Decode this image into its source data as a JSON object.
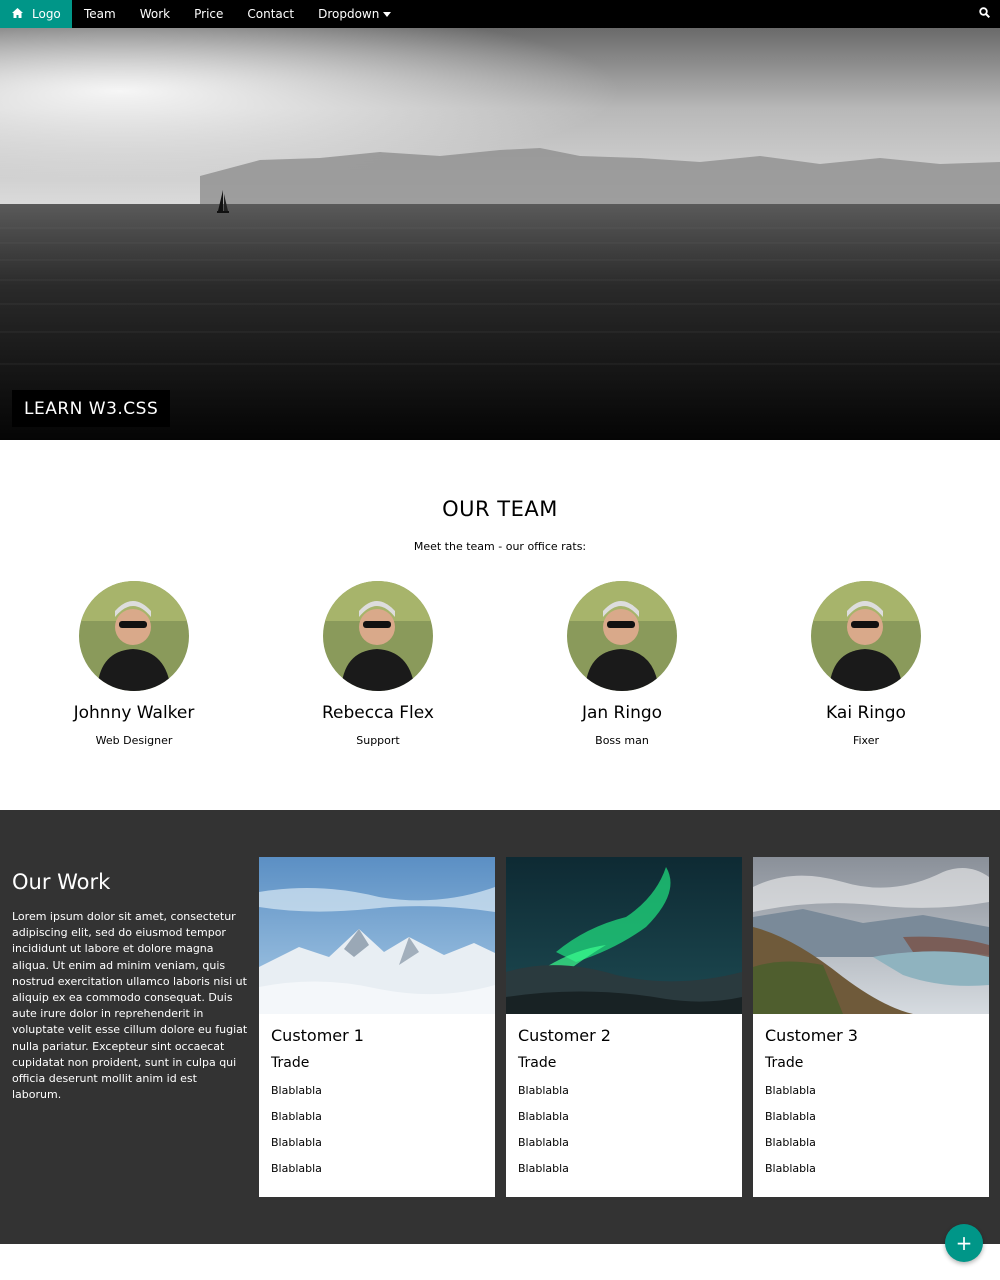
{
  "nav": {
    "logo_label": "Logo",
    "items": [
      {
        "label": "Team"
      },
      {
        "label": "Work"
      },
      {
        "label": "Price"
      },
      {
        "label": "Contact"
      },
      {
        "label": "Dropdown"
      }
    ],
    "accent_color": "#009688"
  },
  "hero": {
    "tag": "LEARN W3.CSS"
  },
  "team": {
    "title": "OUR TEAM",
    "subtitle": "Meet the team - our office rats:",
    "members": [
      {
        "name": "Johnny Walker",
        "role": "Web Designer"
      },
      {
        "name": "Rebecca Flex",
        "role": "Support"
      },
      {
        "name": "Jan Ringo",
        "role": "Boss man"
      },
      {
        "name": "Kai Ringo",
        "role": "Fixer"
      }
    ]
  },
  "work": {
    "title": "Our Work",
    "text": "Lorem ipsum dolor sit amet, consectetur adipiscing elit, sed do eiusmod tempor incididunt ut labore et dolore magna aliqua. Ut enim ad minim veniam, quis nostrud exercitation ullamco laboris nisi ut aliquip ex ea commodo consequat. Duis aute irure dolor in reprehenderit in voluptate velit esse cillum dolore eu fugiat nulla pariatur. Excepteur sint occaecat cupidatat non proident, sunt in culpa qui officia deserunt mollit anim id est laborum.",
    "cards": [
      {
        "name": "Customer 1",
        "trade": "Trade",
        "lines": [
          "Blablabla",
          "Blablabla",
          "Blablabla",
          "Blablabla"
        ]
      },
      {
        "name": "Customer 2",
        "trade": "Trade",
        "lines": [
          "Blablabla",
          "Blablabla",
          "Blablabla",
          "Blablabla"
        ]
      },
      {
        "name": "Customer 3",
        "trade": "Trade",
        "lines": [
          "Blablabla",
          "Blablabla",
          "Blablabla",
          "Blablabla"
        ]
      }
    ]
  },
  "fab": {
    "label": "+"
  }
}
